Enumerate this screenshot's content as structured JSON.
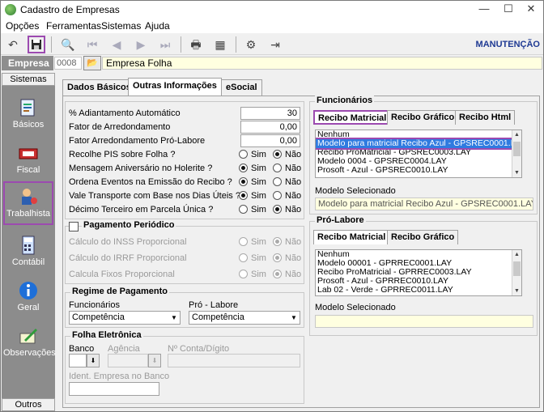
{
  "window": {
    "title": "Cadastro de Empresas",
    "minimize": "—",
    "maximize": "☐",
    "close": "✕"
  },
  "menu": [
    "Opções",
    "Ferramentas",
    "Sistemas",
    "Ajuda"
  ],
  "toolbar": {
    "right_label": "MANUTENÇÃO"
  },
  "empresa": {
    "label": "Empresa",
    "code": "0008",
    "name": "Empresa Folha"
  },
  "sidebar": {
    "header": "Sistemas",
    "footer": "Outros",
    "items": [
      "Básicos",
      "Fiscal",
      "Trabalhista",
      "Contábil",
      "Geral",
      "Observações"
    ]
  },
  "tabs": [
    "Dados Básicos",
    "Outras Informações",
    "eSocial"
  ],
  "form": {
    "adiantamento_label": "% Adiantamento Automático",
    "adiantamento_value": "30",
    "fator_label": "Fator de Arredondamento",
    "fator_value": "0,00",
    "fator_pl_label": "Fator Arredondamento Pró-Labore",
    "fator_pl_value": "0,00",
    "radios": [
      {
        "label": "Recolhe PIS sobre Folha ?",
        "value": "Não"
      },
      {
        "label": "Mensagem Aniversário no Holerite ?",
        "value": "Sim"
      },
      {
        "label": "Ordena Eventos na Emissão do Recibo ?",
        "value": "Sim"
      },
      {
        "label": "Vale Transporte com Base nos Dias Úteis ?",
        "value": "Sim"
      },
      {
        "label": "Décimo Terceiro em Parcela Única ?",
        "value": "Não"
      }
    ],
    "sim": "Sim",
    "nao": "Não"
  },
  "pagamento": {
    "title": "Pagamento Periódico",
    "rows": [
      "Cálculo do INSS Proporcional",
      "Cálculo do IRRF Proporcional",
      "Calcula Fixos Proporcional"
    ]
  },
  "regime": {
    "title": "Regime de Pagamento",
    "func_label": "Funcionários",
    "func_value": "Competência",
    "pl_label": "Pró - Labore",
    "pl_value": "Competência"
  },
  "folha": {
    "title": "Folha Eletrônica",
    "banco": "Banco",
    "agencia": "Agência",
    "conta": "Nº Conta/Dígito",
    "ident": "Ident. Empresa no Banco"
  },
  "funcionarios": {
    "title": "Funcionários",
    "tabs": [
      "Recibo Matricial",
      "Recibo Gráfico",
      "Recibo Html"
    ],
    "list": [
      "Nenhum",
      "Modelo para matricial Recibo Azul - GPSREC0001.LAY",
      "Recibo ProMatricial - GPSREC0003.LAY",
      "Modelo 0004 - GPSREC0004.LAY",
      "Prosoft - Azul - GPSREC0010.LAY"
    ],
    "selected_index": 1,
    "sel_label": "Modelo Selecionado",
    "sel_value": "Modelo para matricial Recibo Azul - GPSREC0001.LAY"
  },
  "prolabore": {
    "title": "Pró-Labore",
    "tabs": [
      "Recibo Matricial",
      "Recibo Gráfico"
    ],
    "list": [
      "Nenhum",
      "Modelo 00001 - GPRREC0001.LAY",
      "Recibo ProMatricial - GPRREC0003.LAY",
      "Prosoft - Azul - GPRREC0010.LAY",
      "Lab 02 - Verde - GPRREC0011.LAY"
    ],
    "sel_label": "Modelo Selecionado",
    "sel_value": ""
  },
  "colors": {
    "highlight": "#9c4ab0",
    "selection": "#2f7be0",
    "manutencao": "#1f3a93"
  }
}
